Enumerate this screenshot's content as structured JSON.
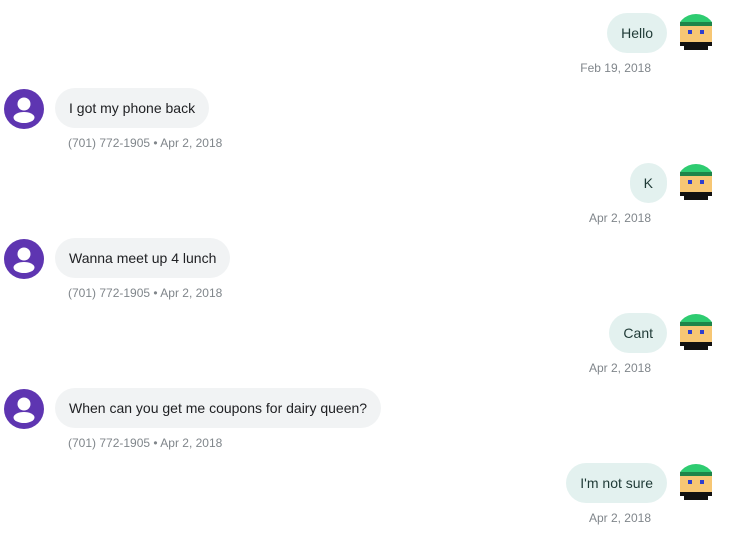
{
  "colors": {
    "outgoing_bubble": "#e3f1ef",
    "incoming_bubble": "#f1f3f4",
    "incoming_avatar": "#5e35b1",
    "meta_text": "#80868b"
  },
  "icons": {
    "outgoing_avatar": "pixel-face-avatar-icon",
    "incoming_avatar": "person-icon"
  },
  "messages": [
    {
      "direction": "outgoing",
      "text": "Hello",
      "meta": "Feb 19, 2018"
    },
    {
      "direction": "incoming",
      "text": "I got my phone back",
      "meta": "(701) 772-1905 • Apr 2, 2018"
    },
    {
      "direction": "outgoing",
      "text": "K",
      "meta": "Apr 2, 2018"
    },
    {
      "direction": "incoming",
      "text": "Wanna meet up 4 lunch",
      "meta": "(701) 772-1905 • Apr 2, 2018"
    },
    {
      "direction": "outgoing",
      "text": "Cant",
      "meta": "Apr 2, 2018"
    },
    {
      "direction": "incoming",
      "text": "When can you get me coupons for dairy queen?",
      "meta": "(701) 772-1905 • Apr 2, 2018"
    },
    {
      "direction": "outgoing",
      "text": "I'm not sure",
      "meta": "Apr 2, 2018"
    }
  ]
}
